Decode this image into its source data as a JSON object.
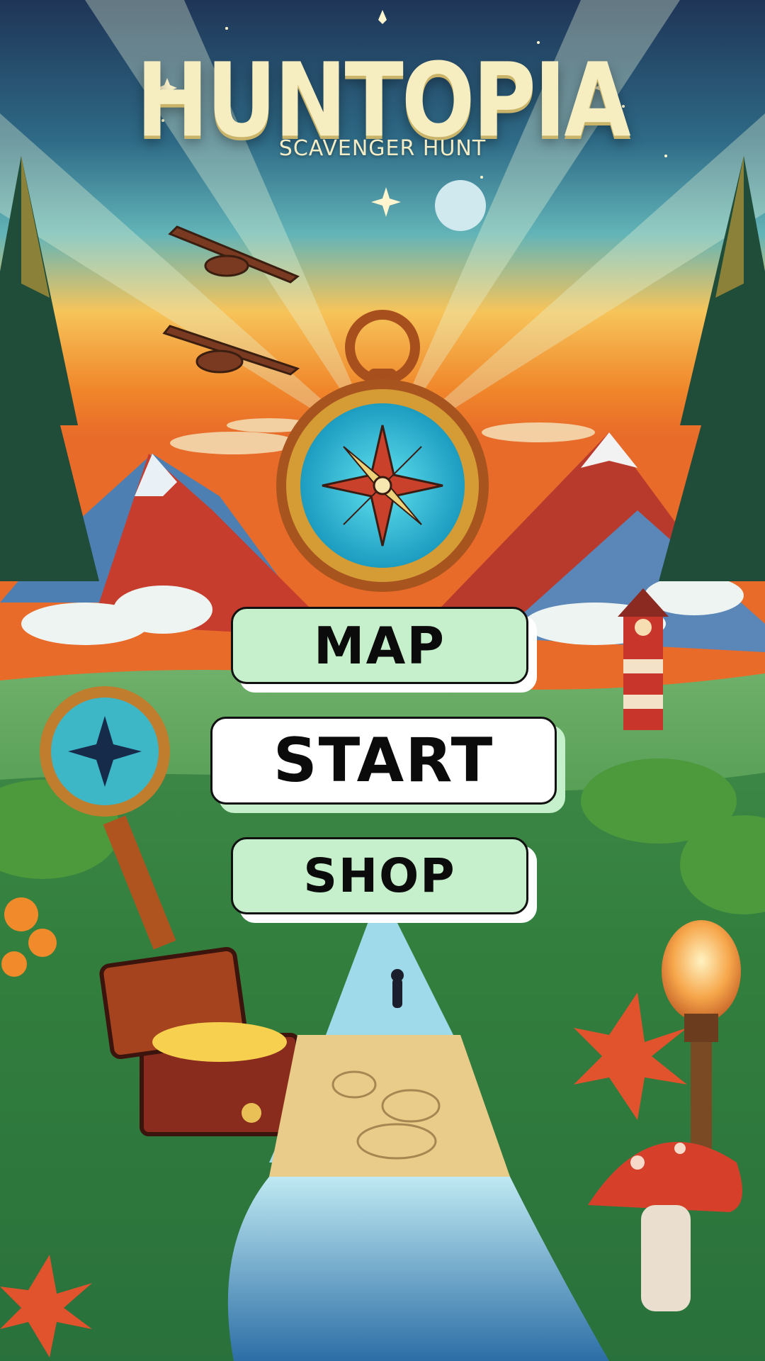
{
  "title": "HUNTOPIA",
  "subtitle": "SCAVENGER HUNT",
  "menu": {
    "map_label": "MAP",
    "start_label": "START",
    "shop_label": "SHOP"
  },
  "colors": {
    "button_green": "#c6efcb",
    "button_white": "#ffffff",
    "title_cream": "#f6eec0",
    "sky_teal": "#3d9fb8",
    "sunset_orange": "#f39a2c"
  },
  "icons": [
    "compass-icon",
    "magnifier-icon",
    "treasure-chest-icon",
    "lighthouse-icon",
    "lightbulb-icon",
    "mushroom-icon",
    "plane-icon",
    "moon-icon"
  ]
}
